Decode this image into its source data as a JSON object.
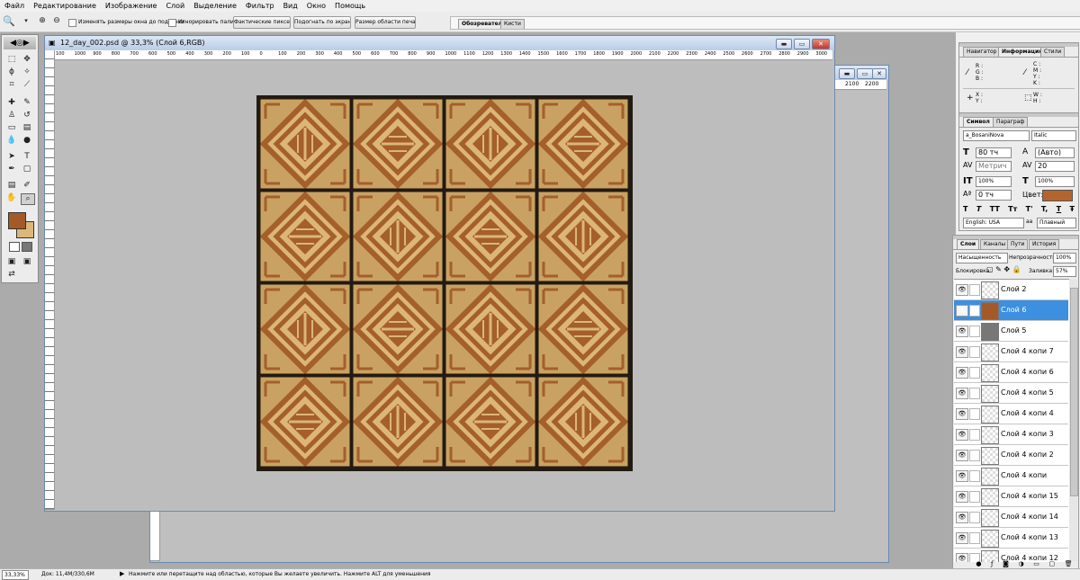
{
  "menu": [
    "Файл",
    "Редактирование",
    "Изображение",
    "Слой",
    "Выделение",
    "Фильтр",
    "Вид",
    "Окно",
    "Помощь"
  ],
  "options": {
    "resize_windows_label": "Изменять размеры окна до подгонки",
    "ignore_palettes_label": "Игнорировать палитру",
    "actual_pixels": "Фактические пикселы",
    "fit_screen": "Подогнать по экрану",
    "print_size": "Размер области печати",
    "tab_browser": "Обозреватель",
    "tab_brushes": "Кисти"
  },
  "document": {
    "title": "12_day_002.psd @ 33,3% (Слой 6,RGB)",
    "ruler_ticks": [
      "100",
      "1000",
      "900",
      "800",
      "700",
      "600",
      "500",
      "400",
      "300",
      "200",
      "100",
      "0",
      "100",
      "200",
      "300",
      "400",
      "500",
      "600",
      "700",
      "800",
      "900",
      "1000",
      "1100",
      "1200",
      "1300",
      "1400",
      "1500",
      "1600",
      "1700",
      "1800",
      "1900",
      "2000",
      "2100",
      "2200",
      "2300",
      "2400",
      "2500",
      "2600",
      "2700",
      "2800",
      "2900",
      "3000"
    ],
    "back_ticks": [
      "2100",
      "2200"
    ]
  },
  "tile": {
    "rows": 4,
    "cols": 4,
    "wood_light": "#dcb677",
    "wood_dark": "#a45f2b",
    "grout": "#231a12"
  },
  "colors": {
    "foreground": "#a45a28",
    "background": "#dcb77c",
    "selection": "#3d8fe0",
    "char_color": "#b5642d"
  },
  "nav_panel": {
    "tabs": [
      "Навигатор",
      "Информация",
      "Стили"
    ],
    "rgb_labels": [
      "R :",
      "G :",
      "B :"
    ],
    "cmyk_labels": [
      "C :",
      "M :",
      "Y :",
      "K :"
    ],
    "xy_labels": [
      "X :",
      "Y :"
    ],
    "wh_labels": [
      "W :",
      "H :"
    ]
  },
  "char_panel": {
    "tabs": [
      "Символ",
      "Параграф"
    ],
    "font": "a_BosaniNova",
    "style": "Italic",
    "size": "80 тч",
    "leading": "(Авто)",
    "kerning": "Метрич",
    "tracking": "20",
    "vscale": "100%",
    "hscale": "100%",
    "baseline": "0 тч",
    "color_label": "Цвет:",
    "style_buttons": [
      "T",
      "T",
      "TT",
      "Tт",
      "T'",
      "T,",
      "T",
      "Ŧ"
    ],
    "language": "English: USA",
    "aa_label": "aa",
    "antialias": "Плавный"
  },
  "layers_panel": {
    "tabs": [
      "Слои",
      "Каналы",
      "Пути",
      "История"
    ],
    "blend_mode": "Насыщенность",
    "opacity_label": "Непрозрачность:",
    "opacity": "100%",
    "lock_label": "Блокировка:",
    "fill_label": "Заливка:",
    "fill": "57%",
    "layers": [
      {
        "name": "Слой 2",
        "selected": false
      },
      {
        "name": "Слой 6",
        "selected": true
      },
      {
        "name": "Слой 5",
        "selected": false
      },
      {
        "name": "Слой 4 копи 7",
        "selected": false
      },
      {
        "name": "Слой 4 копи 6",
        "selected": false
      },
      {
        "name": "Слой 4 копи 5",
        "selected": false
      },
      {
        "name": "Слой 4 копи 4",
        "selected": false
      },
      {
        "name": "Слой 4 копи 3",
        "selected": false
      },
      {
        "name": "Слой 4 копи 2",
        "selected": false
      },
      {
        "name": "Слой 4 копи",
        "selected": false
      },
      {
        "name": "Слой 4 копи 15",
        "selected": false
      },
      {
        "name": "Слой 4 копи 14",
        "selected": false
      },
      {
        "name": "Слой 4 копи 13",
        "selected": false
      },
      {
        "name": "Слой 4 копи 12",
        "selected": false
      }
    ]
  },
  "status": {
    "zoom": "33,33%",
    "doc": "Док: 11,4M/330,6M",
    "hint": "Нажмите или перетащите над областью, которые Вы желаете увеличить. Нажмите ALT для уменьшения"
  }
}
